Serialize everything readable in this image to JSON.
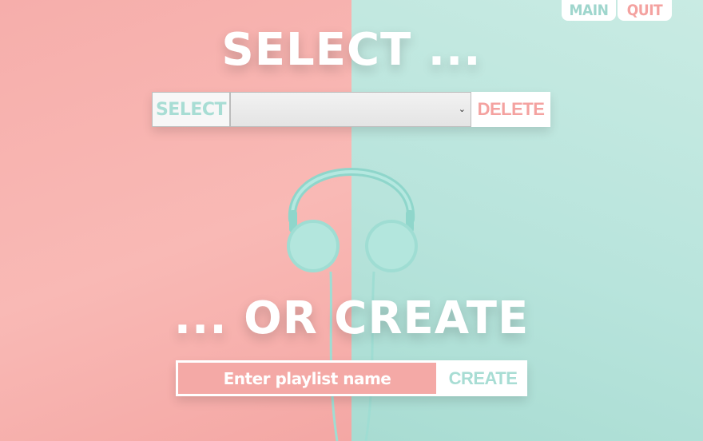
{
  "nav": {
    "main_label": "MAIN",
    "quit_label": "QUIT"
  },
  "select_section": {
    "heading": "SELECT ...",
    "select_label": "SELECT",
    "dropdown_value": "",
    "delete_label": "DELETE"
  },
  "create_section": {
    "heading": "... OR CREATE",
    "input_placeholder": "Enter playlist name",
    "input_value": "",
    "create_label": "CREATE"
  },
  "colors": {
    "pink": "#f6aeab",
    "mint": "#b8e4dc",
    "pink_text": "#f4a2a0",
    "mint_text": "#a8ddd4"
  }
}
